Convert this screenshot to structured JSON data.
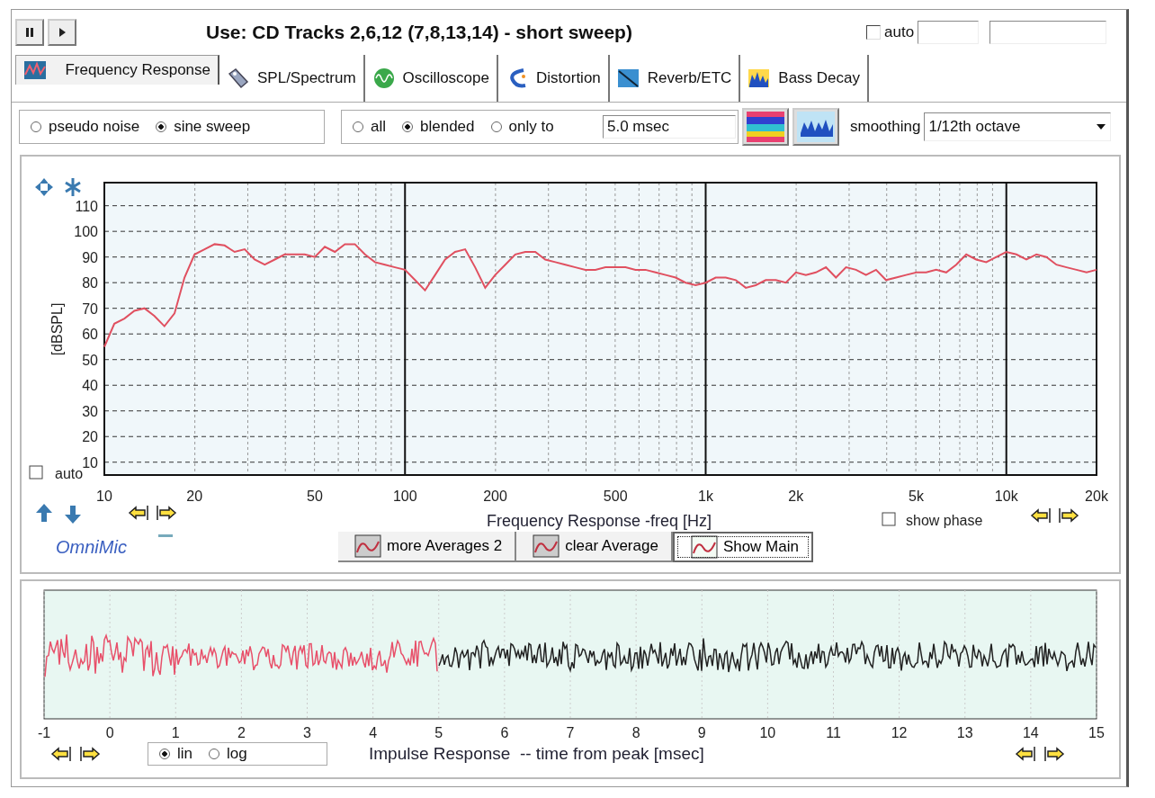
{
  "toolbar": {
    "title": "Use: CD Tracks 2,6,12 (7,8,13,14) - short sweep)",
    "auto": {
      "label": "auto",
      "checked": false
    }
  },
  "tabs": [
    {
      "label": "Frequency Response",
      "selected": true
    },
    {
      "label": "SPL/Spectrum",
      "selected": false
    },
    {
      "label": "Oscilloscope",
      "selected": false
    },
    {
      "label": "Distortion",
      "selected": false
    },
    {
      "label": "Reverb/ETC",
      "selected": false
    },
    {
      "label": "Bass Decay",
      "selected": false
    }
  ],
  "signal_options": [
    {
      "label": "pseudo noise",
      "selected": false
    },
    {
      "label": "sine sweep",
      "selected": true
    }
  ],
  "window_options": [
    {
      "label": "all",
      "selected": false
    },
    {
      "label": "blended",
      "selected": true
    },
    {
      "label": "only to",
      "selected": false
    }
  ],
  "window_time": {
    "value": "5.0 msec"
  },
  "smoothing": {
    "label": "smoothing",
    "value": "1/12th octave"
  },
  "frequency_response": {
    "auto": {
      "label": "auto",
      "checked": false
    },
    "show_phase": {
      "label": "show phase",
      "checked": false
    },
    "brand": "OmniMic",
    "buttons": [
      {
        "label": "more Averages 2",
        "pressed": false
      },
      {
        "label": "clear Average",
        "pressed": false
      },
      {
        "label": "Show Main",
        "pressed": true
      }
    ],
    "chart_data": {
      "type": "line",
      "xlabel": "Frequency Response -freq [Hz]",
      "ylabel": "[dBSPL]",
      "grid": true,
      "ylim": [
        5,
        119
      ],
      "yticks": [
        10,
        20,
        30,
        40,
        50,
        60,
        70,
        80,
        90,
        100,
        110
      ],
      "categories": [
        "10",
        null,
        null,
        null,
        null,
        null,
        null,
        null,
        null,
        "20",
        null,
        null,
        null,
        null,
        null,
        null,
        null,
        null,
        null,
        null,
        null,
        "50",
        null,
        null,
        null,
        null,
        null,
        null,
        null,
        null,
        "100",
        null,
        null,
        null,
        null,
        null,
        null,
        null,
        null,
        "200",
        null,
        null,
        null,
        null,
        null,
        null,
        null,
        null,
        null,
        null,
        null,
        "500",
        null,
        null,
        null,
        null,
        null,
        null,
        null,
        null,
        "1k",
        null,
        null,
        null,
        null,
        null,
        null,
        null,
        null,
        "2k",
        null,
        null,
        null,
        null,
        null,
        null,
        null,
        null,
        null,
        null,
        null,
        "5k",
        null,
        null,
        null,
        null,
        null,
        null,
        null,
        null,
        "10k",
        null,
        null,
        null,
        null,
        null,
        null,
        null,
        null,
        "20k"
      ],
      "series": [
        {
          "color": "#e05060",
          "values": [
            55,
            64,
            66,
            69,
            70,
            67,
            63,
            68,
            82,
            91,
            93,
            95,
            94.5,
            92,
            93,
            89,
            87,
            89,
            91,
            91,
            91,
            90,
            94,
            92,
            95,
            95,
            91,
            88,
            87,
            86,
            85,
            81,
            77,
            83,
            89,
            92,
            93,
            86,
            78,
            83,
            87,
            91,
            92,
            92,
            89,
            88,
            87,
            86,
            85,
            85,
            86,
            86,
            86,
            85,
            85,
            84,
            83,
            82,
            80,
            79,
            80,
            82,
            82,
            81,
            78,
            79,
            81,
            81,
            80,
            84,
            83,
            84,
            86,
            82,
            86,
            85,
            83,
            85,
            81,
            82,
            83,
            84,
            84,
            85,
            84,
            87,
            91,
            89,
            88,
            90,
            92,
            91,
            89,
            91,
            90,
            87,
            86,
            85,
            84,
            85
          ]
        }
      ]
    }
  },
  "impulse_response": {
    "xlabel": "Impulse Response  -- time from peak [msec]",
    "ticks": [
      "-1",
      "0",
      "1",
      "2",
      "3",
      "4",
      "5",
      "6",
      "7",
      "8",
      "9",
      "10",
      "11",
      "12",
      "13",
      "14",
      "15"
    ],
    "scale_options": [
      {
        "label": "lin",
        "selected": true
      },
      {
        "label": "log",
        "selected": false
      }
    ]
  }
}
